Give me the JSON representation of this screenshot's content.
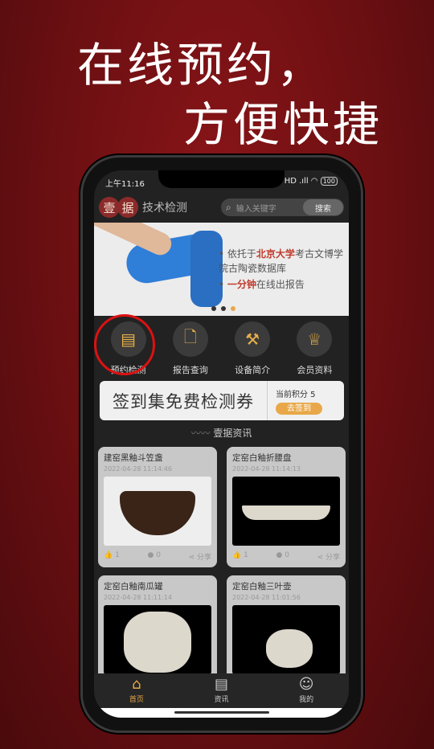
{
  "promo": {
    "line1": "在线预约，",
    "line2": "方便快捷"
  },
  "status": {
    "time": "上午11:16",
    "signal": "HD .ıll",
    "battery": "100"
  },
  "header": {
    "logo_chars": [
      "壹",
      "据"
    ],
    "logo_text": "技术检测",
    "search_placeholder": "输入关键字",
    "search_button": "搜索"
  },
  "banner": {
    "bullet1_pre": "依托于",
    "bullet1_hl": "北京大学",
    "bullet1_post": "考古文博学院古陶瓷数据库",
    "bullet2_hl": "一分钟",
    "bullet2_post": "在线出报告"
  },
  "quick": [
    {
      "label": "预约检测",
      "icon": "calendar-clock-icon"
    },
    {
      "label": "报告查询",
      "icon": "document-search-icon"
    },
    {
      "label": "设备简介",
      "icon": "hammer-device-icon"
    },
    {
      "label": "会员资料",
      "icon": "crown-icon"
    }
  ],
  "signin": {
    "title": "签到集免费检测券",
    "points": "当前积分 5",
    "button": "去签到"
  },
  "section_title": "壹据资讯",
  "cards": [
    {
      "title": "建窑黑釉斗笠盏",
      "date": "2022-04-28 11:14:46",
      "likes": "1",
      "comments": "0",
      "share": "分享"
    },
    {
      "title": "定窑白釉折腰盘",
      "date": "2022-04-28 11:14:13",
      "likes": "1",
      "comments": "0",
      "share": "分享"
    },
    {
      "title": "定窑白釉南瓜罐",
      "date": "2022-04-28 11:11:14"
    },
    {
      "title": "定窑白釉三叶壶",
      "date": "2022-04-28 11:01:56"
    }
  ],
  "tabs": [
    {
      "label": "首页",
      "active": true
    },
    {
      "label": "资讯"
    },
    {
      "label": "我的"
    }
  ],
  "colors": {
    "accent": "#e8a849",
    "highlight": "#c0392b",
    "background": "#6a0f12"
  }
}
